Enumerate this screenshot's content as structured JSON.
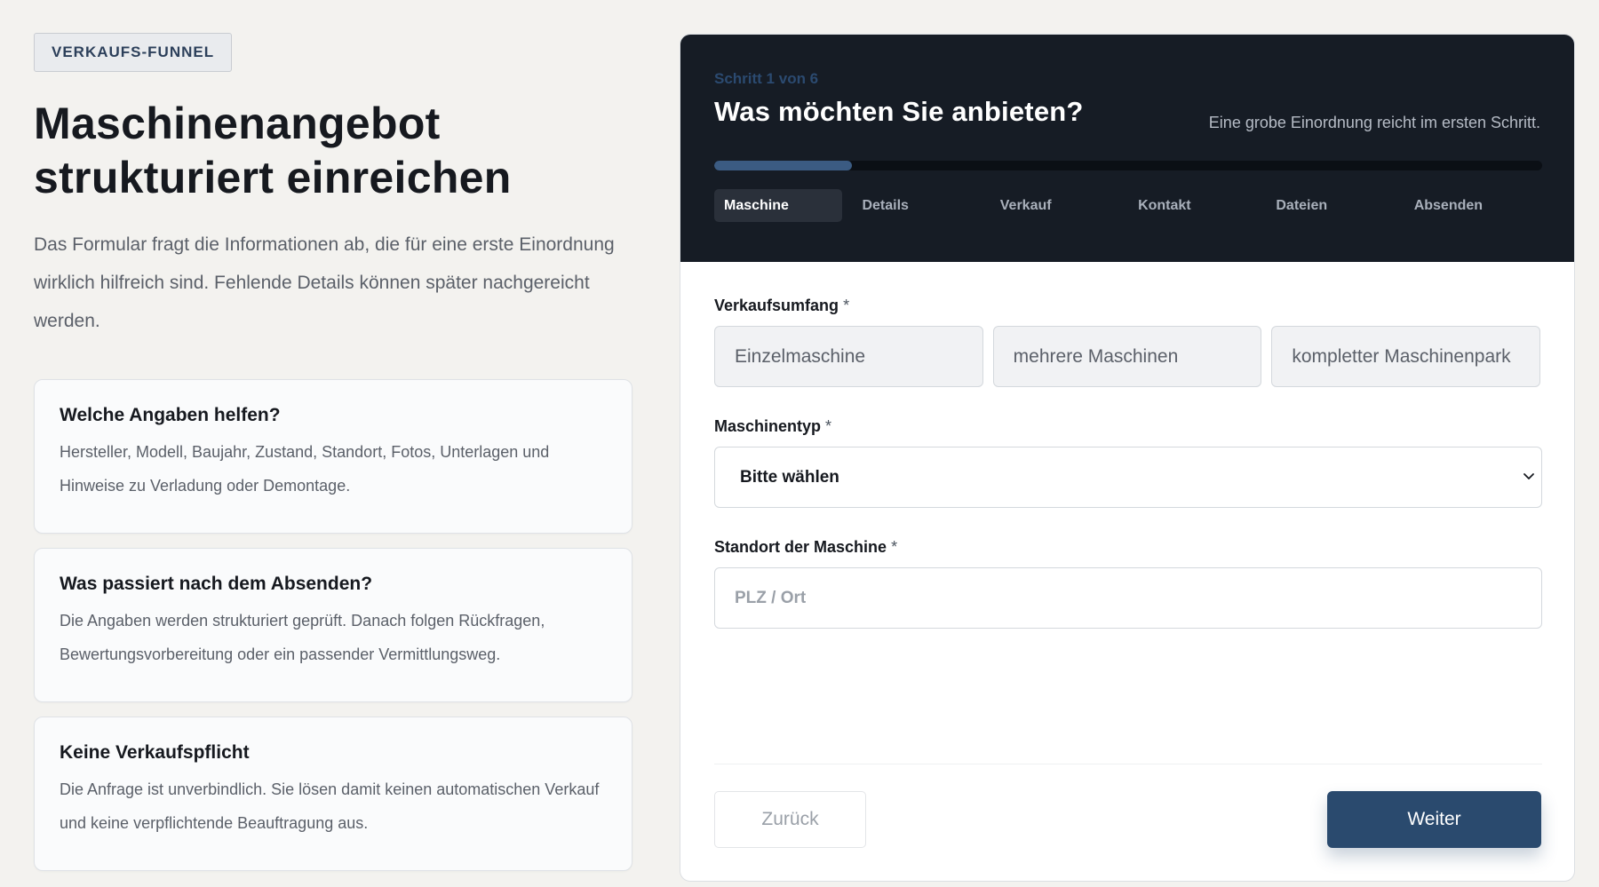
{
  "left": {
    "badge": "VERKAUFS-FUNNEL",
    "title_line1": "Maschinenangebot",
    "title_line2": "strukturiert einreichen",
    "intro": "Das Formular fragt die Informationen ab, die für eine erste Einordnung wirklich hilfreich sind. Fehlende Details können später nachgereicht werden.",
    "cards": [
      {
        "title": "Welche Angaben helfen?",
        "text": "Hersteller, Modell, Baujahr, Zustand, Standort, Fotos, Unterlagen und Hinweise zu Verladung oder Demontage."
      },
      {
        "title": "Was passiert nach dem Absenden?",
        "text": "Die Angaben werden strukturiert geprüft. Danach folgen Rückfragen, Bewertungsvorbereitung oder ein passender Vermittlungsweg."
      },
      {
        "title": "Keine Verkaufspflicht",
        "text": "Die Anfrage ist unverbindlich. Sie lösen damit keinen automatischen Verkauf und keine verpflichtende Beauftragung aus."
      }
    ]
  },
  "form": {
    "step_label": "Schritt 1 von 6",
    "title": "Was möchten Sie anbieten?",
    "hint": "Eine grobe Einordnung reicht im ersten Schritt.",
    "progress": 0.1667,
    "steps": [
      "Maschine",
      "Details",
      "Verkauf",
      "Kontakt",
      "Dateien",
      "Absenden"
    ],
    "active_step": 0,
    "scope_label": "Verkaufsumfang",
    "scope_options": [
      "Einzelmaschine",
      "mehrere Maschinen",
      "kompletter Maschinenpark"
    ],
    "type_label": "Maschinentyp",
    "type_selected": "Bitte wählen",
    "location_label": "Standort der Maschine",
    "location_placeholder": "PLZ / Ort",
    "location_value": "",
    "required_mark": "*",
    "back_label": "Zurück",
    "next_label": "Weiter"
  },
  "colors": {
    "accent": "#2a4a6e",
    "header_bg": "#161c25",
    "progress_fill": "#3b5b82"
  },
  "icons": {
    "select": "chevron-down-icon"
  }
}
